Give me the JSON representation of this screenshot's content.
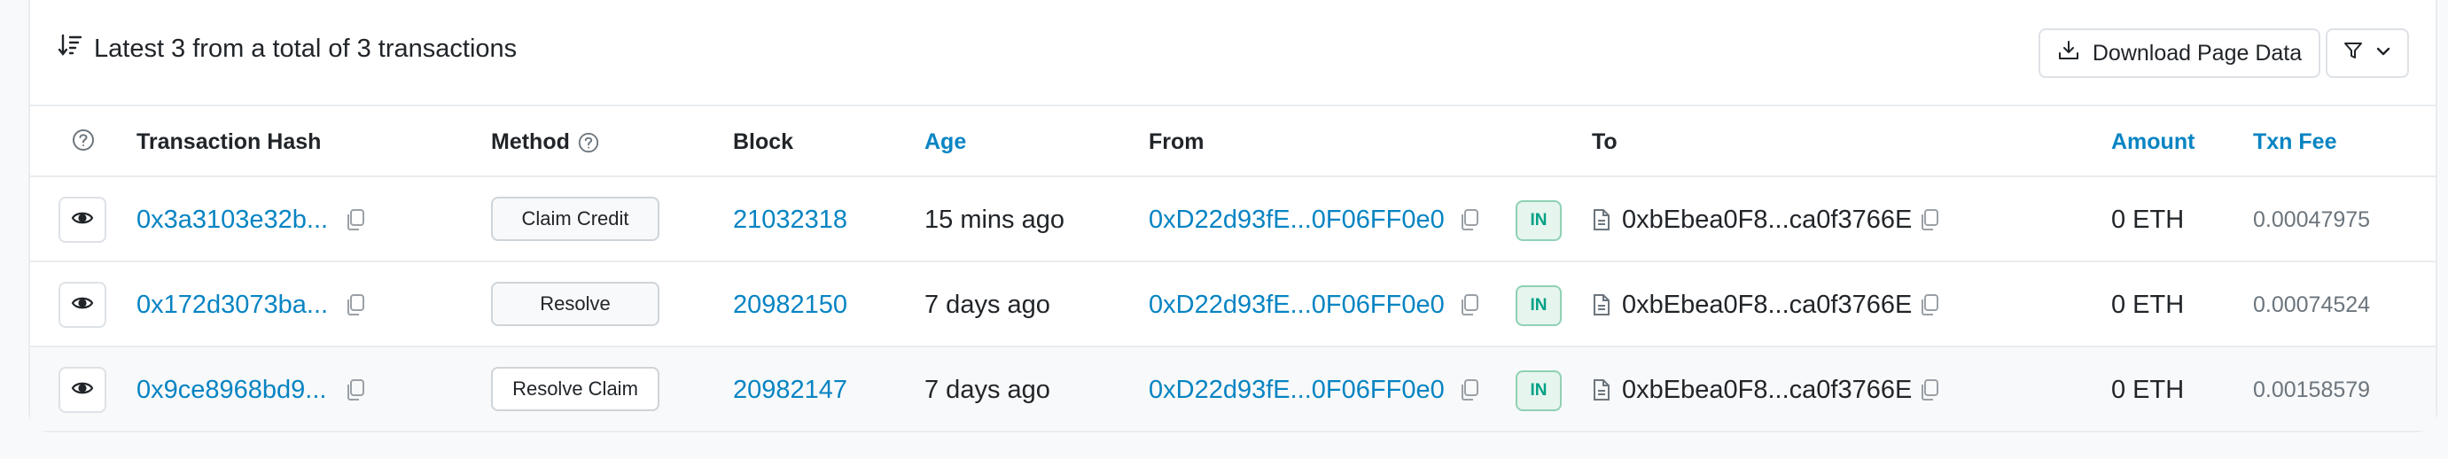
{
  "header": {
    "summary": "Latest 3 from a total of 3 transactions",
    "download_label": "Download Page Data"
  },
  "columns": {
    "hash": "Transaction Hash",
    "method": "Method",
    "block": "Block",
    "age": "Age",
    "from": "From",
    "to": "To",
    "amount": "Amount",
    "fee": "Txn Fee"
  },
  "rows": [
    {
      "hash": "0x3a3103e32b...",
      "method": "Claim Credit",
      "block": "21032318",
      "age": "15 mins ago",
      "from": "0xD22d93fE...0F06FF0e0",
      "direction": "IN",
      "to": "0xbEbea0F8...ca0f3766E",
      "amount": "0 ETH",
      "fee": "0.00047975"
    },
    {
      "hash": "0x172d3073ba...",
      "method": "Resolve",
      "block": "20982150",
      "age": "7 days ago",
      "from": "0xD22d93fE...0F06FF0e0",
      "direction": "IN",
      "to": "0xbEbea0F8...ca0f3766E",
      "amount": "0 ETH",
      "fee": "0.00074524"
    },
    {
      "hash": "0x9ce8968bd9...",
      "method": "Resolve Claim",
      "block": "20982147",
      "age": "7 days ago",
      "from": "0xD22d93fE...0F06FF0e0",
      "direction": "IN",
      "to": "0xbEbea0F8...ca0f3766E",
      "amount": "0 ETH",
      "fee": "0.00158579"
    }
  ],
  "colors": {
    "link": "#0784c3",
    "in_badge_text": "#00a186",
    "in_badge_bg": "#e6f5ee"
  },
  "icons": {
    "sort": "sort-desc-icon",
    "download": "download-icon",
    "filter": "filter-icon",
    "chevron": "chevron-down-icon",
    "help": "question-circle-icon",
    "eye": "eye-icon",
    "copy": "copy-icon",
    "contract": "file-icon"
  }
}
